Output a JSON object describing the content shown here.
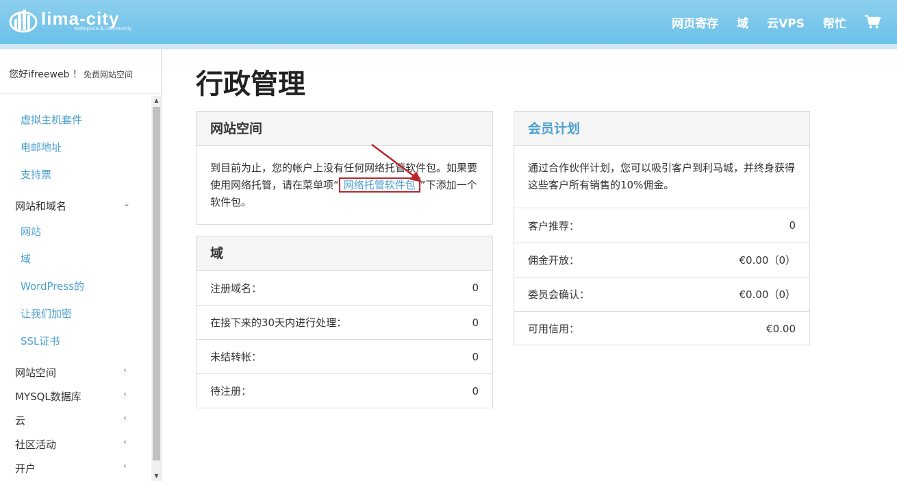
{
  "header": {
    "logo_name": "lima-city",
    "logo_sub": "webspace & community",
    "nav": [
      "网页寄存",
      "域",
      "云VPS",
      "帮忙"
    ]
  },
  "sidebar": {
    "greeting": "您好ifreeweb ！",
    "greeting_sub": "免费网站空间",
    "items": [
      {
        "label": "虚拟主机套件",
        "level": "sub"
      },
      {
        "label": "电邮地址",
        "level": "sub"
      },
      {
        "label": "支持票",
        "level": "sub"
      },
      {
        "label": "网站和域名",
        "level": "top",
        "chevron": "down"
      },
      {
        "label": "网站",
        "level": "sub"
      },
      {
        "label": "域",
        "level": "sub"
      },
      {
        "label": "WordPress的",
        "level": "sub"
      },
      {
        "label": "让我们加密",
        "level": "sub"
      },
      {
        "label": "SSL证书",
        "level": "sub"
      },
      {
        "label": "网站空间",
        "level": "top",
        "chevron": "left"
      },
      {
        "label": "MYSQL数据库",
        "level": "top",
        "chevron": "left"
      },
      {
        "label": "云",
        "level": "top",
        "chevron": "left"
      },
      {
        "label": "社区活动",
        "level": "top",
        "chevron": "left"
      },
      {
        "label": "开户",
        "level": "top",
        "chevron": "left"
      }
    ]
  },
  "main": {
    "title": "行政管理",
    "webspace": {
      "title": "网站空间",
      "text_before": "到目前为止，您的帐户上没有任何网络托管软件包。如果要使用网络托管，请在菜单项“",
      "link": "网络托管软件包",
      "text_after": "”下添加一个软件包。"
    },
    "domains": {
      "title": "域",
      "rows": [
        {
          "label": "注册域名：",
          "value": "0"
        },
        {
          "label": "在接下来的30天内进行处理：",
          "value": "0"
        },
        {
          "label": "未结转帐：",
          "value": "0"
        },
        {
          "label": "待注册：",
          "value": "0"
        }
      ]
    },
    "partner": {
      "title": "会员计划",
      "text": "通过合作伙伴计划，您可以吸引客户到利马城，并终身获得这些客户所有销售的10%佣金。",
      "rows": [
        {
          "label": "客户推荐：",
          "value": "0"
        },
        {
          "label": "佣金开放：",
          "value": "€0.00（0）"
        },
        {
          "label": "委员会确认：",
          "value": "€0.00（0）"
        },
        {
          "label": "可用信用：",
          "value": "€0.00"
        }
      ]
    }
  },
  "colors": {
    "header": "#6cc0e8",
    "link": "#4a9fd0",
    "highlight_box": "#b8262b",
    "arrow": "#b8262b"
  }
}
